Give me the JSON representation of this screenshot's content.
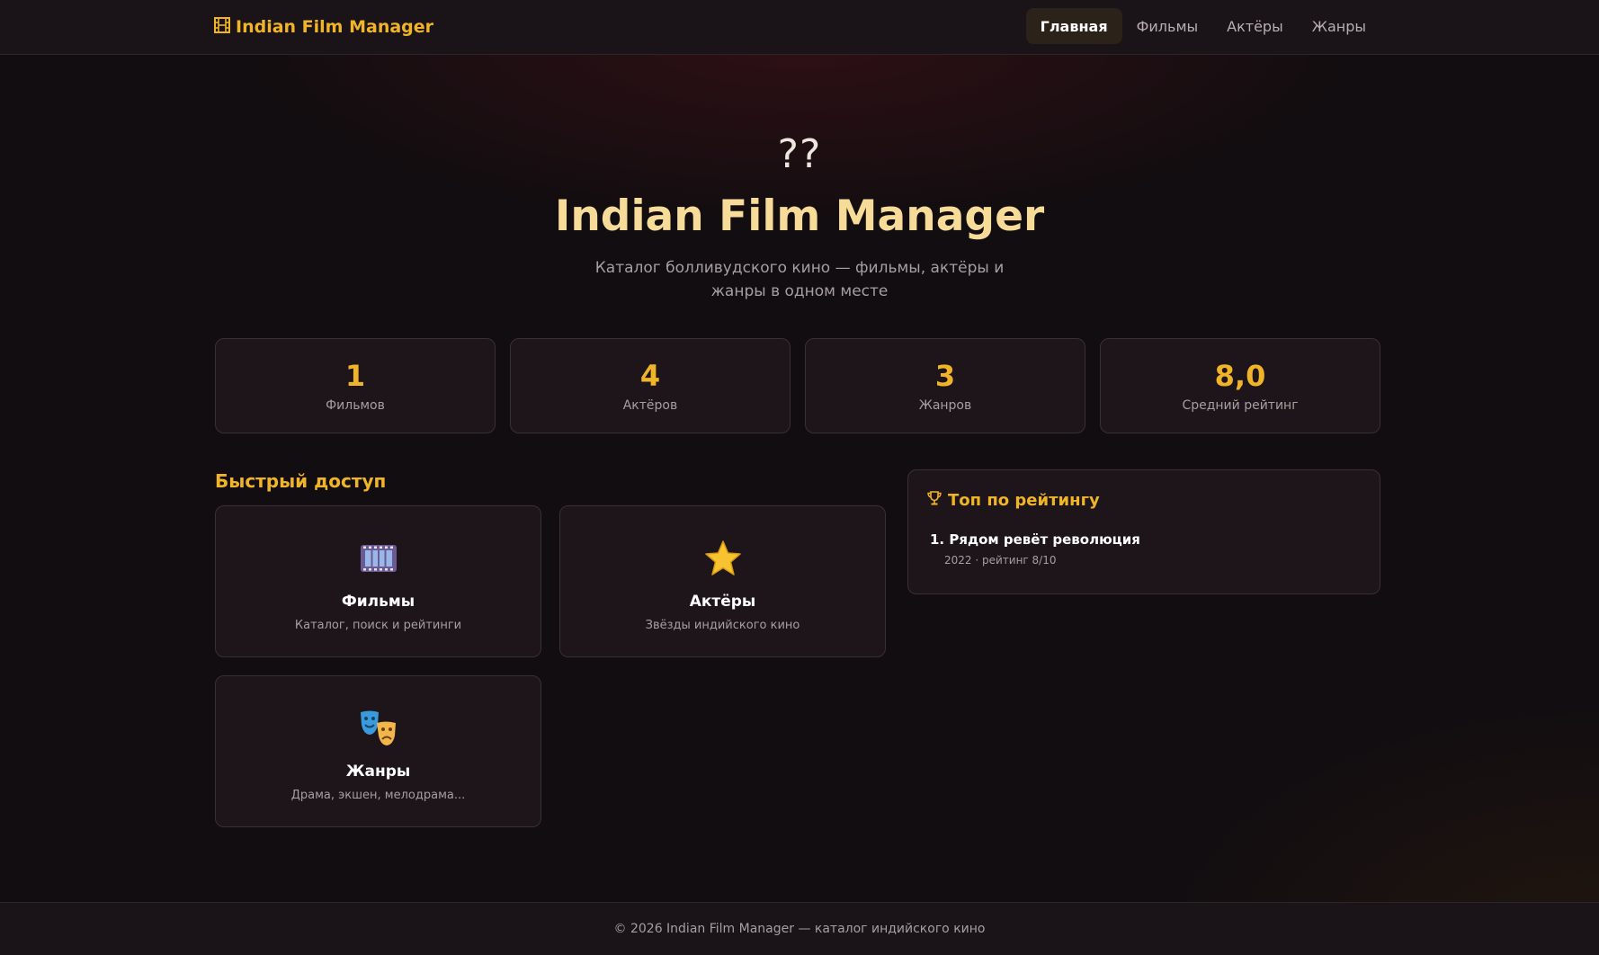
{
  "header": {
    "brand_icon": "film-frame-icon",
    "brand_label": "Indian Film Manager",
    "nav": [
      {
        "label": "Главная",
        "active": true
      },
      {
        "label": "Фильмы",
        "active": false
      },
      {
        "label": "Актёры",
        "active": false
      },
      {
        "label": "Жанры",
        "active": false
      }
    ]
  },
  "hero": {
    "emoji_text": "??",
    "title": "Indian Film Manager",
    "subtitle": "Каталог болливудского кино — фильмы, актёры и жанры в одном месте"
  },
  "stats": [
    {
      "value": "1",
      "label": "Фильмов"
    },
    {
      "value": "4",
      "label": "Актёров"
    },
    {
      "value": "3",
      "label": "Жанров"
    },
    {
      "value": "8,0",
      "label": "Средний рейтинг"
    }
  ],
  "quick_access": {
    "title": "Быстрый доступ",
    "cards": [
      {
        "icon": "film-strip-icon",
        "title": "Фильмы",
        "desc": "Каталог, поиск и рейтинги"
      },
      {
        "icon": "star-icon",
        "title": "Актёры",
        "desc": "Звёзды индийского кино"
      },
      {
        "icon": "theater-masks-icon",
        "title": "Жанры",
        "desc": "Драма, экшен, мелодрама..."
      }
    ]
  },
  "top": {
    "icon": "trophy-icon",
    "title": "Топ по рейтингу",
    "items": [
      {
        "title": "1. Рядом ревёт революция",
        "meta": "2022 · рейтинг 8/10"
      }
    ]
  },
  "footer": {
    "text": "© 2026 Indian Film Manager — каталог индийского кино"
  },
  "colors": {
    "accent": "#f0b429",
    "hero_title": "#f6dc98",
    "background": "#120d10",
    "card": "#1d1519"
  }
}
